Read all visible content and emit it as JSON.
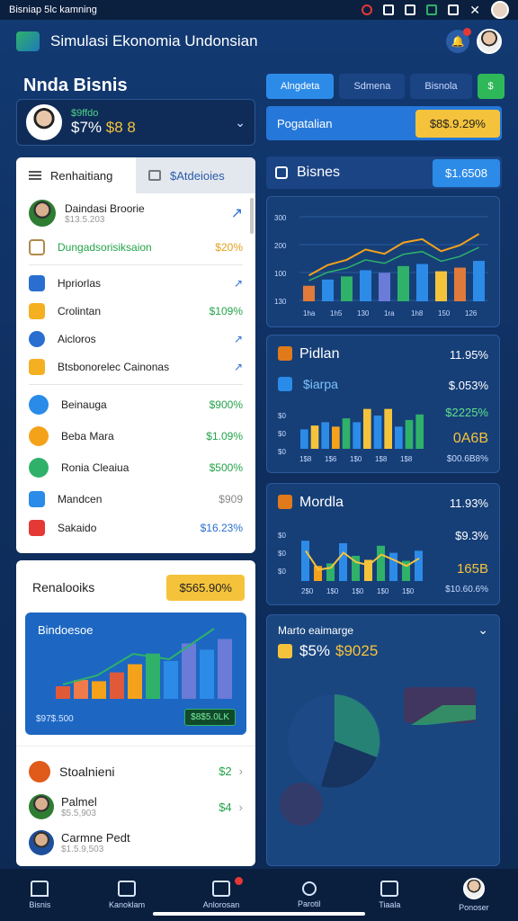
{
  "status_bar": {
    "title": "Bisniap 5lc kamning"
  },
  "app": {
    "title": "Simulasi Ekonomia Undonsian"
  },
  "profile": {
    "title": "Nnda Bisnis",
    "sub": "$9ffdo",
    "value_a": "$7%",
    "value_b": "$8 8"
  },
  "tabs": [
    "Renhaitiang",
    "$Atdeioies"
  ],
  "list": {
    "top": {
      "name": "Daindasi Broorie",
      "sub": "$13.5.203"
    },
    "highlight": {
      "label": "Dungadsorisiksaion",
      "value": "$20%"
    },
    "items": [
      {
        "label": "Hpriorlas",
        "value": ""
      },
      {
        "label": "Crolintan",
        "value": "$109%"
      },
      {
        "label": "Aicloros",
        "value": ""
      },
      {
        "label": "Btsbonorelec Cainonas",
        "value": ""
      }
    ],
    "items2": [
      {
        "label": "Beinauga",
        "value": "$900%"
      },
      {
        "label": "Beba Mara",
        "value": "$1.09%"
      },
      {
        "label": "Ronia Cleaiua",
        "value": "$500%"
      },
      {
        "label": "Mandcen",
        "value": "$909"
      },
      {
        "label": "Sakaido",
        "value": "$16.23%"
      }
    ]
  },
  "revenue": {
    "title": "Renalooiks",
    "badge": "$565.90%",
    "chart_title": "Bindoesoe",
    "chart_footer": "$97$.500",
    "chart_pill": "$8$5.0LK",
    "contacts_title": "Stoalnieni",
    "contacts_title_val": "$2",
    "contacts": [
      {
        "name": "Palmel",
        "sub": "$5.5,903",
        "value": "$4"
      },
      {
        "name": "Carmne Pedt",
        "sub": "$1.5.9,503",
        "value": ""
      }
    ]
  },
  "segments": [
    "Alngdeta",
    "Sdmena",
    "Bisnola",
    "$"
  ],
  "search": {
    "label": "Pogatalian",
    "badge": "$8$.9.29%"
  },
  "business": {
    "title": "Bisnes",
    "pill": "$1.6508"
  },
  "panels": [
    {
      "title": "Pidlan",
      "pct": "11.95%",
      "sub": "$iarpa",
      "v1": "$.053%",
      "v2": "$2225%",
      "v3": "0A6B",
      "v4": "$00.6B8%",
      "accent": "#f5c33b"
    },
    {
      "title": "Mordla",
      "pct": "11.93%",
      "v1": "$9.3%",
      "v2": "165B",
      "v3": "$10.60.6%",
      "accent": "#f5c33b"
    }
  ],
  "pie_panel": {
    "title": "Marto eaimarge",
    "value_a": "$5%",
    "value_b": "$9025"
  },
  "bottom_nav": [
    {
      "label": "Bisnis",
      "icon": "home-icon"
    },
    {
      "label": "Kanoklam",
      "icon": "briefcase-icon"
    },
    {
      "label": "Anlorosan",
      "icon": "chart-icon"
    },
    {
      "label": "Parotil",
      "icon": "person-icon"
    },
    {
      "label": "Tiaala",
      "icon": "calendar-icon"
    },
    {
      "label": "Ponoser",
      "icon": "avatar"
    }
  ],
  "chart_data": [
    {
      "type": "bar",
      "categories": [
        "1",
        "2",
        "3",
        "4",
        "5",
        "6",
        "7",
        "8",
        "9",
        "10"
      ],
      "series": [
        {
          "values": [
            30,
            42,
            48,
            60,
            55,
            68,
            72,
            58,
            65,
            78
          ]
        }
      ],
      "ylabel": "",
      "ylim": [
        0,
        300
      ],
      "yticks": [
        "300",
        "200",
        "100",
        "130"
      ],
      "xticks": [
        "1ha",
        "1h5",
        "130",
        "1ra",
        "1h8",
        "150",
        "126"
      ]
    },
    {
      "type": "bar",
      "categories": [
        "1",
        "2",
        "3",
        "4",
        "5",
        "6",
        "7",
        "8",
        "9",
        "10",
        "11",
        "12"
      ],
      "values": [
        35,
        42,
        48,
        40,
        55,
        48,
        72,
        60,
        72,
        40,
        52,
        62
      ],
      "ylim": [
        0,
        100
      ],
      "yticks": [
        "$0",
        "$0",
        "$0"
      ],
      "xticks": [
        "1$8",
        "1$6",
        "1$0",
        "1$8",
        "1$8"
      ]
    },
    {
      "type": "bar",
      "categories": [
        "1",
        "2",
        "3",
        "4",
        "5",
        "6",
        "7",
        "8",
        "9",
        "10"
      ],
      "values": [
        80,
        30,
        35,
        75,
        50,
        42,
        70,
        56,
        40,
        60
      ],
      "ylim": [
        0,
        100
      ],
      "yticks": [
        "$0",
        "$0",
        "$0"
      ],
      "xticks": [
        "2$0",
        "1$0",
        "1$0",
        "1$0",
        "1$0"
      ]
    }
  ]
}
